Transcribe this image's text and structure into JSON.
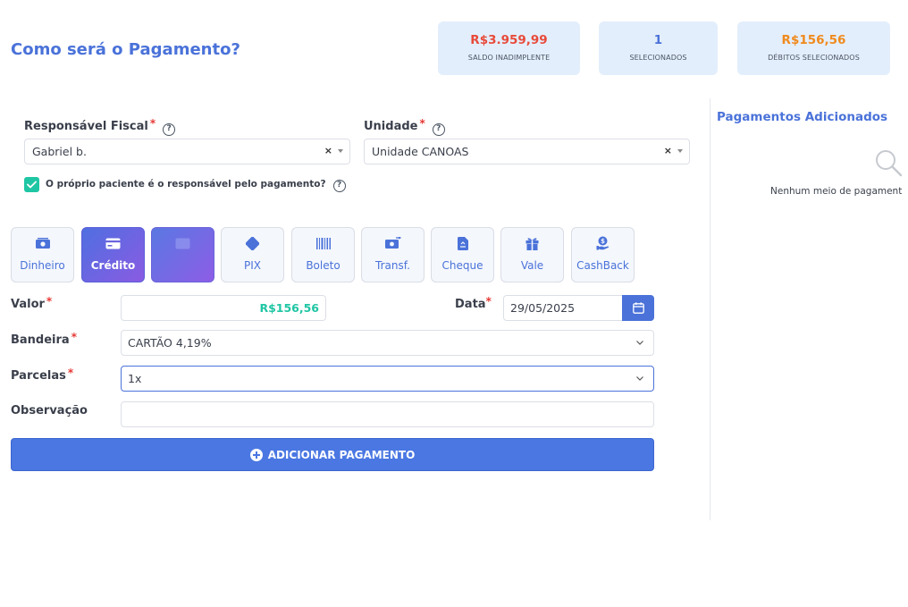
{
  "header": {
    "title": "Como será o Pagamento?"
  },
  "stats": {
    "saldo": {
      "value": "R$3.959,99",
      "label": "SALDO INADIMPLENTE",
      "color": "#e84a3a"
    },
    "selecionados": {
      "value": "1",
      "label": "SELECIONADOS",
      "color": "#4a72d9"
    },
    "debitos": {
      "value": "R$156,56",
      "label": "DÉBITOS SELECIONADOS",
      "color": "#f08a1c"
    }
  },
  "responsavel": {
    "label": "Responsável Fiscal",
    "required_mark": "*",
    "help": "?",
    "value": "Gabriel b.",
    "clear": "×"
  },
  "unidade": {
    "label": "Unidade",
    "required_mark": "*",
    "help": "?",
    "value": "Unidade CANOAS",
    "clear": "×"
  },
  "paciente_checkbox": {
    "checked": true,
    "label": "O próprio paciente é o responsável pelo pagamento?",
    "help": "?"
  },
  "payment_methods": [
    {
      "label": "Dinheiro",
      "icon": "cash-icon",
      "active": false
    },
    {
      "label": "Crédito",
      "icon": "credit-card-icon",
      "active": true
    },
    {
      "label": "",
      "icon": "debit-card-icon",
      "active": false
    },
    {
      "label": "PIX",
      "icon": "pix-icon",
      "active": false
    },
    {
      "label": "Boleto",
      "icon": "barcode-icon",
      "active": false
    },
    {
      "label": "Transf.",
      "icon": "transfer-icon",
      "active": false
    },
    {
      "label": "Cheque",
      "icon": "cheque-icon",
      "active": false
    },
    {
      "label": "Vale",
      "icon": "gift-icon",
      "active": false
    },
    {
      "label": "CashBack",
      "icon": "cashback-icon",
      "active": false
    }
  ],
  "form": {
    "valor": {
      "label": "Valor",
      "required_mark": "*",
      "value": "R$156,56"
    },
    "data": {
      "label": "Data",
      "required_mark": "*",
      "value": "29/05/2025"
    },
    "bandeira": {
      "label": "Bandeira",
      "required_mark": "*",
      "value": "CARTÃO 4,19%"
    },
    "parcelas": {
      "label": "Parcelas",
      "required_mark": "*",
      "value": "1x"
    },
    "observacao": {
      "label": "Observação",
      "value": ""
    }
  },
  "add_button": {
    "label": "ADICIONAR PAGAMENTO"
  },
  "sidebar": {
    "title": "Pagamentos Adicionados",
    "empty_text": "Nenhum meio de pagament"
  }
}
